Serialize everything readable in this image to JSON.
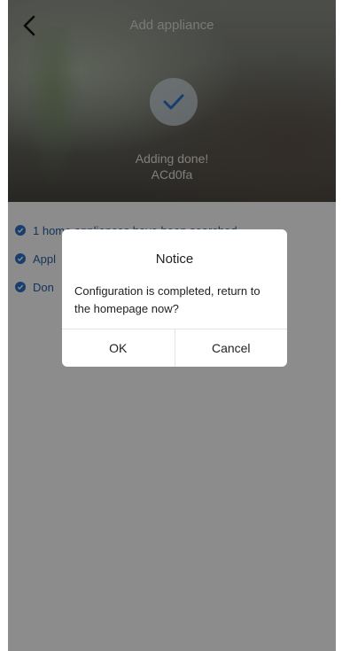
{
  "header": {
    "title": "Add appliance"
  },
  "progress": {
    "status": "Adding done!",
    "device_name": "ACd0fa"
  },
  "status_list": [
    {
      "text": "1 home appliances have been searched"
    },
    {
      "text": "Appl"
    },
    {
      "text": "Don"
    }
  ],
  "dialog": {
    "title": "Notice",
    "message": "Configuration is completed, return to the homepage now?",
    "ok_label": "OK",
    "cancel_label": "Cancel"
  },
  "colors": {
    "accent": "#2d72c8",
    "overlay": "#000000"
  }
}
